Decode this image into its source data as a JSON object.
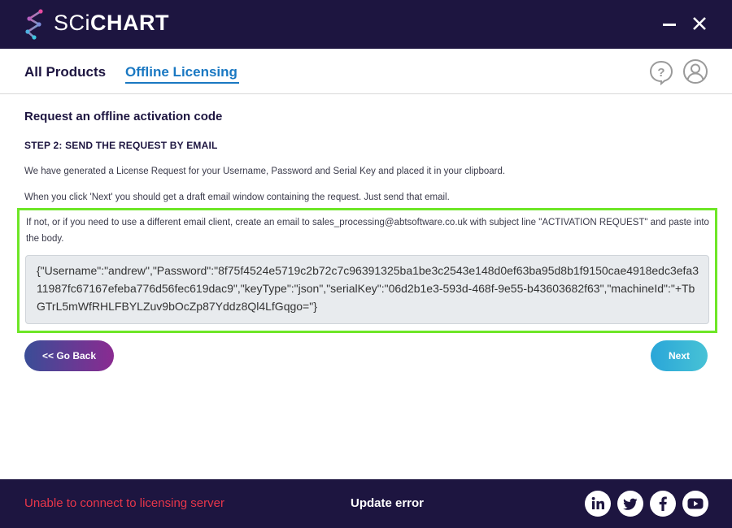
{
  "titlebar": {
    "brand_thin": "SCi",
    "brand_bold": "CHART",
    "minimize_icon": "minimize-icon",
    "close_icon": "close-icon"
  },
  "tabs": [
    {
      "label": "All Products",
      "active": false
    },
    {
      "label": "Offline Licensing",
      "active": true
    }
  ],
  "header_icons": [
    "help-icon",
    "user-icon"
  ],
  "main": {
    "title": "Request an offline activation code",
    "step": "STEP 2: SEND THE REQUEST BY EMAIL",
    "para1": "We have generated a License Request for your Username, Password and Serial Key and placed it in your clipboard.",
    "para2": "When you click 'Next' you should get a draft email window containing the request. Just send that email.",
    "para3": "If not, or if you need to use a different email client, create an email to sales_processing@abtsoftware.co.uk with subject line \"ACTIVATION REQUEST\" and paste into the body.",
    "request_text": "{\"Username\":\"andrew\",\"Password\":\"8f75f4524e5719c2b72c7c96391325ba1be3c2543e148d0ef63ba95d8b1f9150cae4918edc3efa311987fc67167efeba776d56fec619dac9\",\"keyType\":\"json\",\"serialKey\":\"06d2b1e3-593d-468f-9e55-b43603682f63\",\"machineId\":\"+TbGTrL5mWfRHLFBYLZuv9bOcZp87Yddz8Ql4LfGqgo=\"}"
  },
  "buttons": {
    "back": "<< Go Back",
    "next": "Next"
  },
  "footer": {
    "error": "Unable to connect to licensing server",
    "update": "Update error",
    "social": [
      "linkedin-icon",
      "twitter-icon",
      "facebook-icon",
      "youtube-icon"
    ]
  },
  "colors": {
    "navy": "#1d1540",
    "accent_blue": "#1a78c2",
    "highlight_green": "#6ee627",
    "error_red": "#e8364a"
  }
}
